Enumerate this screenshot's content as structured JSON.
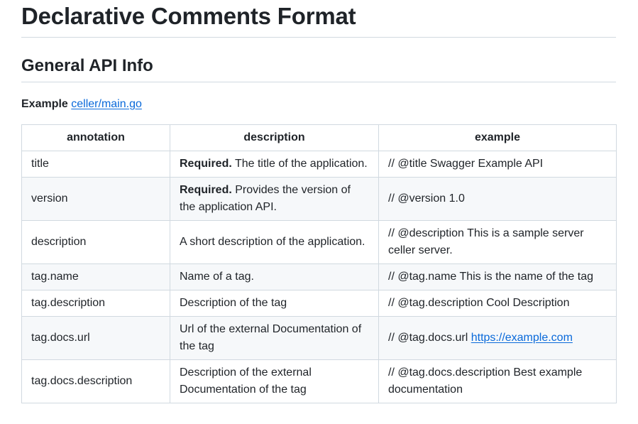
{
  "title": "Declarative Comments Format",
  "section_title": "General API Info",
  "example": {
    "label": "Example",
    "link_text": "celler/main.go"
  },
  "table": {
    "headers": [
      "annotation",
      "description",
      "example"
    ],
    "rows": [
      {
        "annotation": "title",
        "description_bold": "Required.",
        "description": " The title of the application.",
        "example": "// @title Swagger Example API",
        "example_link": ""
      },
      {
        "annotation": "version",
        "description_bold": "Required.",
        "description": " Provides the version of the application API.",
        "example": "// @version 1.0",
        "example_link": ""
      },
      {
        "annotation": "description",
        "description_bold": "",
        "description": "A short description of the application.",
        "example": "// @description This is a sample server celler server.",
        "example_link": ""
      },
      {
        "annotation": "tag.name",
        "description_bold": "",
        "description": "Name of a tag.",
        "example": "// @tag.name This is the name of the tag",
        "example_link": ""
      },
      {
        "annotation": "tag.description",
        "description_bold": "",
        "description": "Description of the tag",
        "example": "// @tag.description Cool Description",
        "example_link": ""
      },
      {
        "annotation": "tag.docs.url",
        "description_bold": "",
        "description": "Url of the external Documentation of the tag",
        "example": "// @tag.docs.url ",
        "example_link": "https://example.com"
      },
      {
        "annotation": "tag.docs.description",
        "description_bold": "",
        "description": "Description of the external Documentation of the tag",
        "example": "// @tag.docs.description Best example documentation",
        "example_link": ""
      }
    ]
  }
}
